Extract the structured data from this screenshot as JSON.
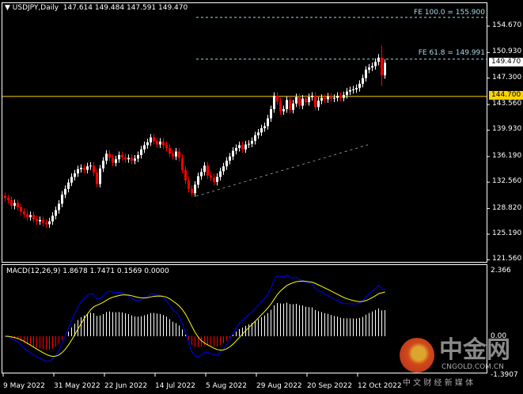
{
  "header": {
    "symbol_timeframe": "USDJPY,Daily",
    "ohlc": "147.614 149.484 147.591 149.470"
  },
  "levels": {
    "fe100": {
      "label": "FE 100.0 = 155.900",
      "price": 155.9
    },
    "fe618": {
      "label": "FE 61.8 = 149.991",
      "price": 149.991
    },
    "hline": {
      "label": "144.700",
      "price": 144.7
    },
    "current": {
      "label": "149.470",
      "price": 149.47
    }
  },
  "price_axis": [
    "154.670",
    "150.930",
    "147.300",
    "143.560",
    "139.930",
    "136.190",
    "132.560",
    "128.820",
    "125.190",
    "121.560"
  ],
  "macd_panel": {
    "label": "MACD(12,26,9) 1.8678 1.7471 0.1569 0.0000",
    "axis": [
      "2.366",
      "0.00",
      "-1.3907"
    ]
  },
  "date_axis": [
    "9 May 2022",
    "31 May 2022",
    "22 Jun 2022",
    "14 Jul 2022",
    "5 Aug 2022",
    "29 Aug 2022",
    "20 Sep 2022",
    "12 Oct 2022"
  ],
  "watermark": {
    "brand": "中金网",
    "domain": "CNGOLD.COM.CN",
    "tagline": "中 文 财 经 新 媒 体"
  },
  "colors": {
    "bull": "#ffffff",
    "bear": "#ff0000",
    "hline": "#ffd400",
    "fe": "#a8d8ea",
    "macd": "#0000ff",
    "signal": "#ffff00"
  },
  "chart_data": {
    "type": "candlestick",
    "symbol": "USDJPY",
    "timeframe": "Daily",
    "ylim": [
      121.56,
      156.5
    ],
    "closes": [
      130.3,
      130.0,
      129.2,
      129.6,
      129.0,
      128.4,
      128.0,
      127.6,
      127.9,
      127.3,
      127.0,
      127.2,
      126.8,
      126.6,
      127.0,
      127.8,
      128.6,
      129.5,
      130.8,
      131.6,
      132.5,
      133.3,
      133.8,
      134.4,
      134.6,
      134.3,
      134.8,
      134.9,
      133.9,
      132.3,
      134.5,
      135.6,
      136.6,
      136.0,
      135.3,
      135.8,
      136.4,
      136.1,
      135.8,
      136.0,
      135.6,
      135.9,
      136.4,
      137.2,
      137.8,
      138.2,
      138.9,
      138.4,
      137.9,
      138.3,
      137.8,
      137.4,
      136.6,
      136.2,
      136.9,
      136.0,
      134.3,
      132.8,
      131.6,
      131.0,
      132.2,
      133.4,
      134.0,
      134.9,
      133.5,
      133.2,
      132.6,
      133.3,
      134.1,
      134.8,
      135.6,
      136.2,
      137.0,
      137.4,
      137.8,
      137.2,
      137.9,
      138.0,
      138.4,
      139.2,
      139.6,
      140.2,
      140.5,
      141.6,
      142.9,
      144.8,
      144.0,
      142.6,
      142.9,
      144.2,
      142.8,
      143.7,
      144.6,
      143.4,
      144.4,
      143.9,
      144.6,
      144.8,
      143.2,
      144.1,
      144.5,
      144.3,
      144.7,
      144.4,
      144.5,
      144.8,
      144.5,
      144.9,
      145.4,
      145.6,
      145.7,
      145.9,
      146.5,
      147.3,
      148.5,
      148.8,
      149.0,
      149.6,
      150.2,
      147.7,
      149.47
    ],
    "macd_params": [
      12,
      26,
      9
    ],
    "macd_ylim": [
      -1.3907,
      2.366
    ]
  }
}
